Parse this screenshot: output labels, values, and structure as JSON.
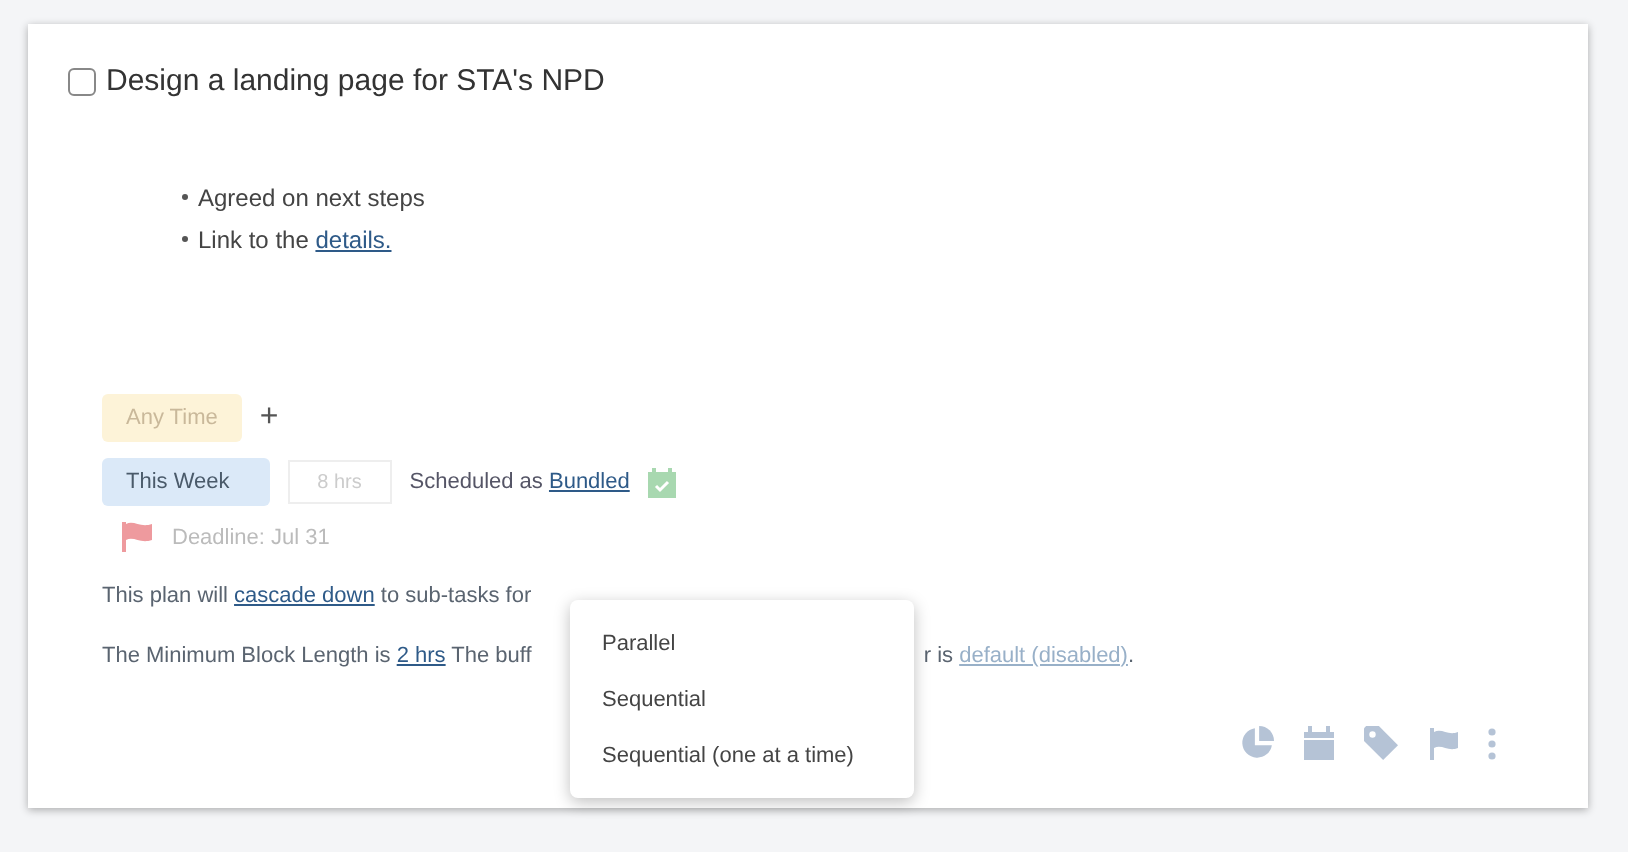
{
  "task": {
    "title": "Design a landing page for STA's NPD",
    "checked": false
  },
  "notes": [
    {
      "parts": [
        {
          "kind": "text",
          "text": "Agreed on next steps"
        }
      ]
    },
    {
      "parts": [
        {
          "kind": "text",
          "text": "Link to the "
        },
        {
          "kind": "link",
          "text": "details."
        }
      ]
    }
  ],
  "when": {
    "label": "Any Time",
    "add": "+"
  },
  "plan": {
    "label": "This Week",
    "hours_placeholder": "8 hrs",
    "scheduled_text": "Scheduled as",
    "scheduled_link": "Bundled"
  },
  "deadline": "Deadline: Jul 31",
  "cascade_line": [
    {
      "kind": "text",
      "text": "This plan will "
    },
    {
      "kind": "link",
      "text": "cascade down"
    },
    {
      "kind": "text",
      "text": " to sub-tasks for"
    }
  ],
  "block_line_left": [
    {
      "kind": "text",
      "text": "The Minimum Block Length is "
    },
    {
      "kind": "link",
      "text": "2 hrs"
    },
    {
      "kind": "text",
      "text": " The buff"
    }
  ],
  "block_line_right": [
    {
      "kind": "text",
      "text": "r is "
    },
    {
      "kind": "muted-link",
      "text": "default (disabled)"
    },
    {
      "kind": "text",
      "text": "."
    }
  ],
  "menu": [
    "Parallel",
    "Sequential",
    "Sequential (one at a time)"
  ]
}
